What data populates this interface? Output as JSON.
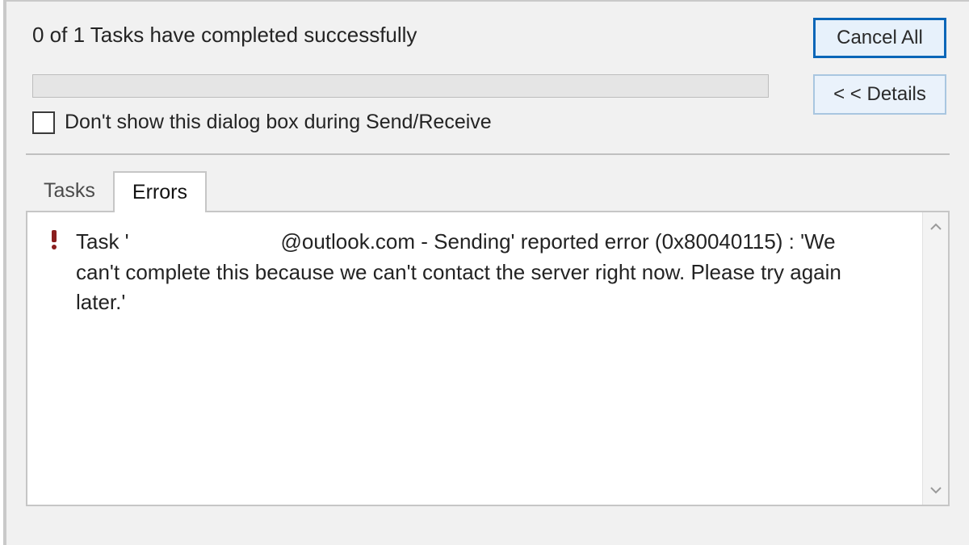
{
  "status_text": "0 of 1 Tasks have completed successfully",
  "buttons": {
    "cancel_all": "Cancel All",
    "details": "< < Details"
  },
  "checkbox_label": "Don't show this dialog box during Send/Receive",
  "tabs": {
    "tasks": "Tasks",
    "errors": "Errors"
  },
  "error_message": "Task '                          @outlook.com - Sending' reported error (0x80040115) : 'We can't complete this because we can't contact the server right now. Please try again later.'"
}
